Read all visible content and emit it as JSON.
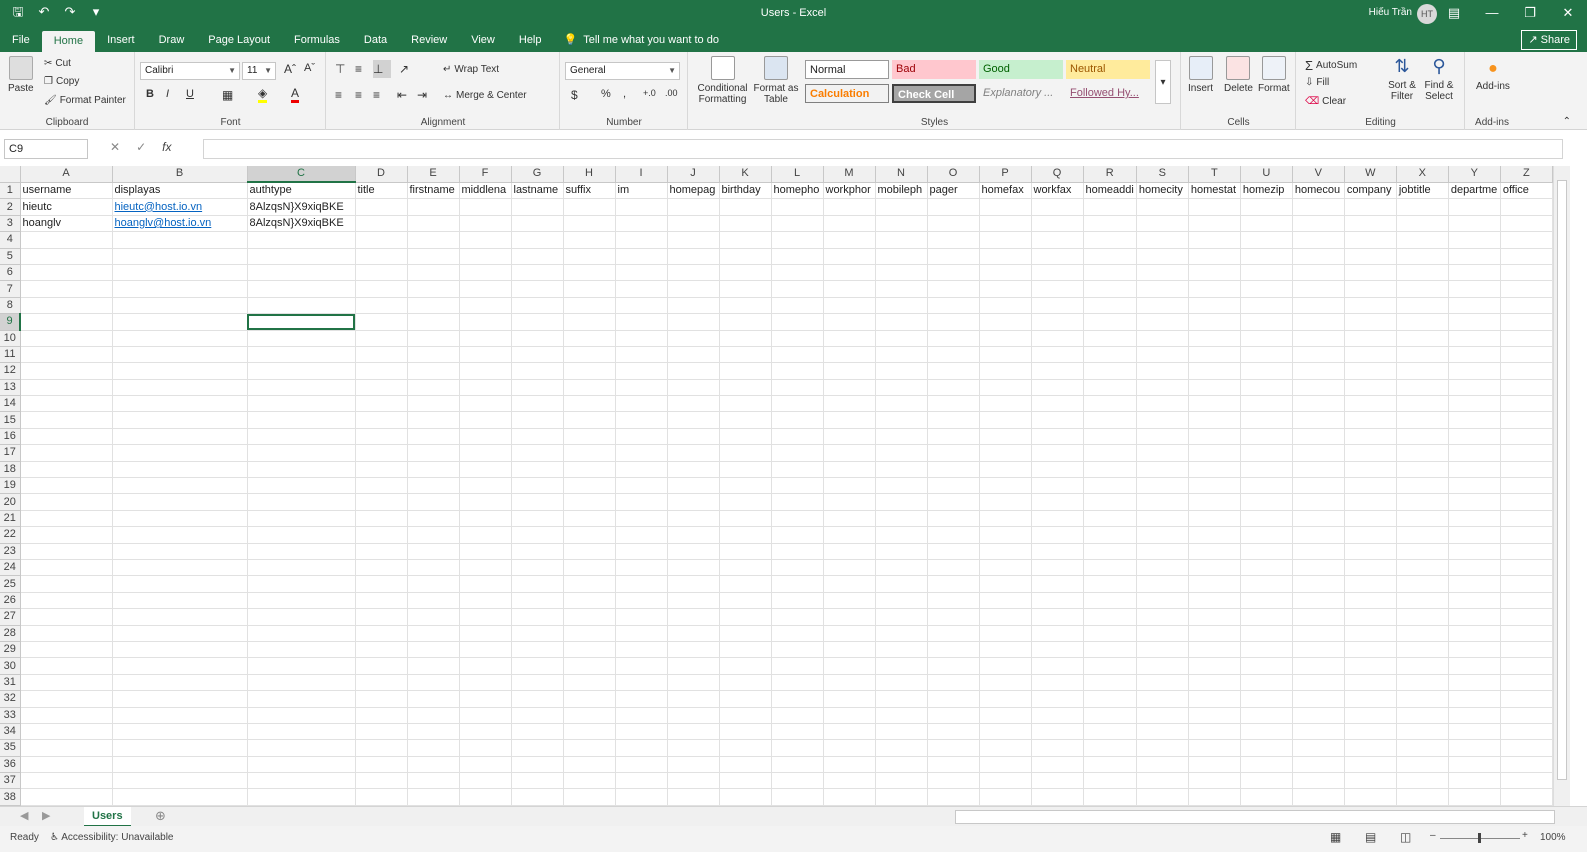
{
  "window": {
    "title": "Users  -  Excel",
    "user_name": "Hiếu Trần",
    "user_initials": "HT"
  },
  "tabs": [
    "File",
    "Home",
    "Insert",
    "Draw",
    "Page Layout",
    "Formulas",
    "Data",
    "Review",
    "View",
    "Help"
  ],
  "tell_me": "Tell me what you want to do",
  "share_label": "Share",
  "ribbon": {
    "clipboard": {
      "label": "Clipboard",
      "paste": "Paste",
      "cut": "Cut",
      "copy": "Copy",
      "format_painter": "Format Painter"
    },
    "font": {
      "label": "Font",
      "name": "Calibri",
      "size": "11"
    },
    "alignment": {
      "label": "Alignment",
      "wrap": "Wrap Text",
      "merge": "Merge & Center"
    },
    "number": {
      "label": "Number",
      "format": "General"
    },
    "styles": {
      "label": "Styles",
      "conditional": "Conditional Formatting",
      "format_table": "Format as Table",
      "normal": "Normal",
      "bad": "Bad",
      "good": "Good",
      "neutral": "Neutral",
      "calculation": "Calculation",
      "check_cell": "Check Cell",
      "explanatory": "Explanatory ...",
      "followed": "Followed Hy..."
    },
    "cells": {
      "label": "Cells",
      "insert": "Insert",
      "delete": "Delete",
      "format": "Format"
    },
    "editing": {
      "label": "Editing",
      "autosum": "AutoSum",
      "fill": "Fill",
      "clear": "Clear",
      "sort": "Sort & Filter",
      "find": "Find & Select"
    },
    "addins": {
      "label": "Add-ins",
      "addins": "Add-ins"
    }
  },
  "formula_bar": {
    "name_box": "C9",
    "formula": ""
  },
  "columns": [
    "A",
    "B",
    "C",
    "D",
    "E",
    "F",
    "G",
    "H",
    "I",
    "J",
    "K",
    "L",
    "M",
    "N",
    "O",
    "P",
    "Q",
    "R",
    "S",
    "T",
    "U",
    "V",
    "W",
    "X",
    "Y",
    "Z"
  ],
  "header_row": [
    "username",
    "displayas",
    "authtype",
    "title",
    "firstname",
    "middlena",
    "lastname",
    "suffix",
    "im",
    "homepag",
    "birthday",
    "homepho",
    "workphor",
    "mobileph",
    "pager",
    "homefax",
    "workfax",
    "homeaddi",
    "homecity",
    "homestat",
    "homezip",
    "homecou",
    "company",
    "jobtitle",
    "departme",
    "office"
  ],
  "rows": [
    [
      "hieutc",
      "hieutc@host.io.vn",
      "8AlzqsN}X9xiqBKE"
    ],
    [
      "hoanglv",
      "hoanglv@host.io.vn",
      "8AlzqsN}X9xiqBKE"
    ]
  ],
  "row_count": 38,
  "selected_cell": "C9",
  "sheet_tab": "Users",
  "status": {
    "ready": "Ready",
    "accessibility": "Accessibility: Unavailable",
    "zoom": "100%"
  },
  "colors": {
    "accent": "#217346",
    "link": "#0563c1"
  }
}
